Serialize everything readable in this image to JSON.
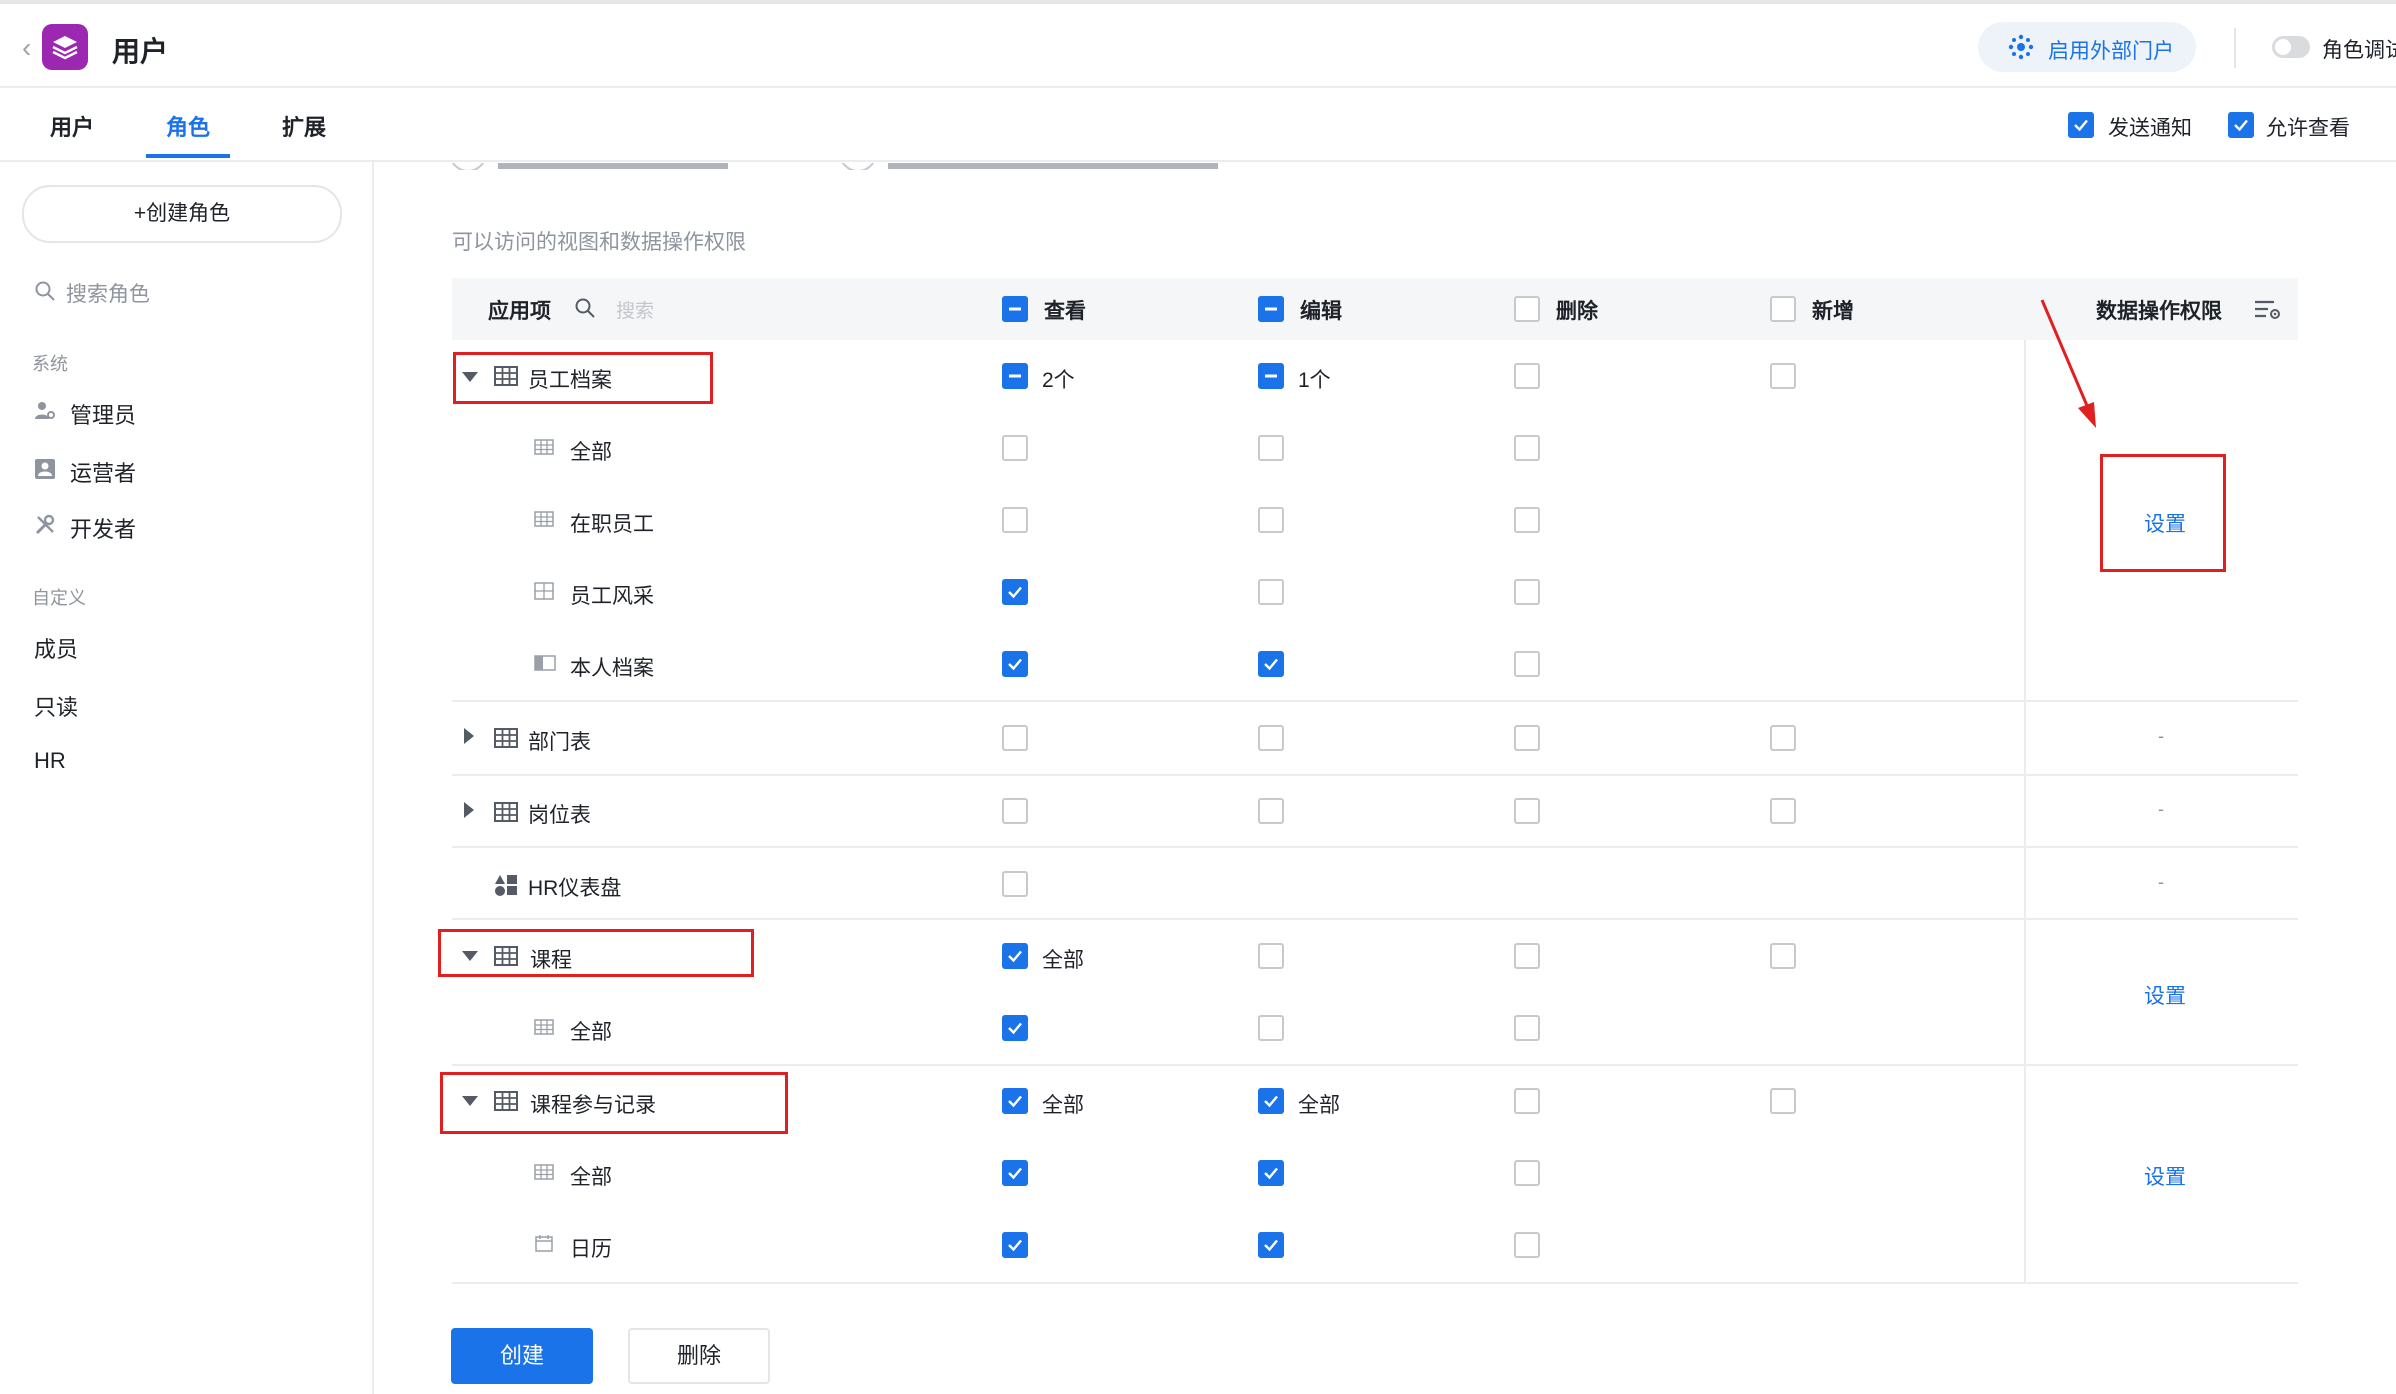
{
  "header": {
    "title": "用户",
    "portal_button": "启用外部门户",
    "role_debug_label": "角色调试",
    "accent": "#1a73e8",
    "app_icon_color": "#9c27b0"
  },
  "tabs": [
    {
      "label": "用户",
      "active": false
    },
    {
      "label": "角色",
      "active": true
    },
    {
      "label": "扩展",
      "active": false
    }
  ],
  "header_options": {
    "notify_label": "发送通知",
    "notify_checked": true,
    "allow_view_label": "允许查看",
    "allow_view_checked": true
  },
  "sidebar": {
    "create_button": "+创建角色",
    "search_placeholder": "搜索角色",
    "groups": [
      {
        "label": "系统",
        "items": [
          {
            "label": "管理员",
            "icon": "user-gear-icon"
          },
          {
            "label": "运营者",
            "icon": "id-card-icon"
          },
          {
            "label": "开发者",
            "icon": "tools-icon"
          }
        ]
      },
      {
        "label": "自定义",
        "items": [
          {
            "label": "成员"
          },
          {
            "label": "只读"
          },
          {
            "label": "HR"
          }
        ]
      }
    ]
  },
  "main": {
    "section_title": "可以访问的视图和数据操作权限",
    "columns": {
      "app_item": "应用项",
      "search_placeholder": "搜索",
      "view": "查看",
      "edit": "编辑",
      "delete": "删除",
      "add": "新增",
      "data_perm": "数据操作权限"
    },
    "rows": {
      "r1": {
        "name": "员工档案",
        "view_text": "2个",
        "edit_text": "1个"
      },
      "r1a": {
        "name": "全部"
      },
      "r1b": {
        "name": "在职员工"
      },
      "r1c": {
        "name": "员工风采"
      },
      "r1d": {
        "name": "本人档案"
      },
      "r2": {
        "name": "部门表"
      },
      "r3": {
        "name": "岗位表"
      },
      "r4": {
        "name": "HR仪表盘"
      },
      "r5": {
        "name": "课程",
        "view_text": "全部"
      },
      "r5a": {
        "name": "全部"
      },
      "r6": {
        "name": "课程参与记录",
        "view_text": "全部",
        "edit_text": "全部"
      },
      "r6a": {
        "name": "全部"
      },
      "r6b": {
        "name": "日历"
      }
    },
    "set_link": "设置",
    "dash": "-",
    "create_button": "创建",
    "delete_button": "删除"
  }
}
